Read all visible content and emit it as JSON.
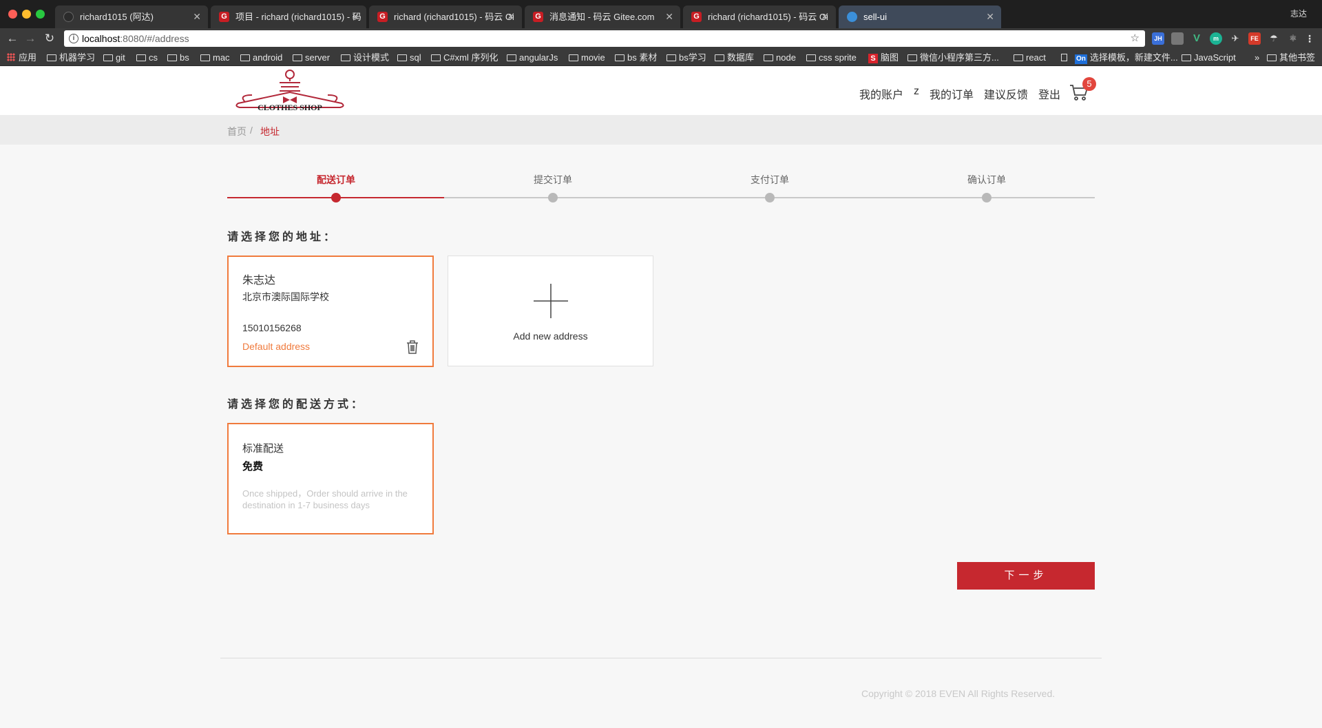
{
  "browser": {
    "tabs": [
      {
        "title": "richard1015 (阿达)",
        "favicon": "github-icon",
        "active": false
      },
      {
        "title": "项目 - richard (richard1015) - 码",
        "favicon": "gitee-icon",
        "active": false
      },
      {
        "title": "richard (richard1015) - 码云 Gi",
        "favicon": "gitee-icon",
        "active": false
      },
      {
        "title": "消息通知 - 码云 Gitee.com",
        "favicon": "gitee-icon",
        "active": false
      },
      {
        "title": "richard (richard1015) - 码云 Gi",
        "favicon": "gitee-icon",
        "active": false
      },
      {
        "title": "sell-ui",
        "favicon": "site-icon",
        "active": true
      }
    ],
    "user_name": "志达",
    "address": {
      "host": "localhost",
      "rest": ":8080/#/address"
    },
    "bookmarks": [
      {
        "label": "应用",
        "kind": "apps"
      },
      {
        "label": "机器学习",
        "kind": "folder"
      },
      {
        "label": "git",
        "kind": "folder"
      },
      {
        "label": "cs",
        "kind": "folder"
      },
      {
        "label": "bs",
        "kind": "folder"
      },
      {
        "label": "mac",
        "kind": "folder"
      },
      {
        "label": "android",
        "kind": "folder"
      },
      {
        "label": "server",
        "kind": "folder"
      },
      {
        "label": "设计模式",
        "kind": "folder"
      },
      {
        "label": "sql",
        "kind": "folder"
      },
      {
        "label": "C#xml 序列化",
        "kind": "folder"
      },
      {
        "label": "angularJs",
        "kind": "folder"
      },
      {
        "label": "movie",
        "kind": "folder"
      },
      {
        "label": "bs 素材",
        "kind": "folder"
      },
      {
        "label": "bs学习",
        "kind": "folder"
      },
      {
        "label": "数据库",
        "kind": "folder"
      },
      {
        "label": "node",
        "kind": "folder"
      },
      {
        "label": "css sprite",
        "kind": "folder"
      },
      {
        "label": "脑图",
        "kind": "s"
      },
      {
        "label": "微信小程序第三方...",
        "kind": "folder"
      },
      {
        "label": "react",
        "kind": "folder"
      },
      {
        "label": "",
        "kind": "doc"
      },
      {
        "label": "选择模板，新建文件...",
        "kind": "on"
      },
      {
        "label": "JavaScript",
        "kind": "folder"
      }
    ],
    "more_bookmarks": "»",
    "other_bookmarks": "其他书签"
  },
  "header": {
    "logo_text": "CLOTHES SHOP",
    "nav": [
      "我的账户",
      "z",
      "我的订单",
      "建议反馈",
      "登出"
    ],
    "cart_count": "5"
  },
  "breadcrumb": {
    "home": "首页",
    "separator": "/",
    "current": "地址"
  },
  "steps": [
    {
      "label": "配送订单",
      "active": true
    },
    {
      "label": "提交订单",
      "active": false
    },
    {
      "label": "支付订单",
      "active": false
    },
    {
      "label": "确认订单",
      "active": false
    }
  ],
  "address_section": {
    "title": "请选择您的地址：",
    "address": {
      "name": "朱志达",
      "line": "北京市澳际国际学校",
      "phone": "15010156268",
      "default_label": "Default address"
    },
    "add_label": "Add new address"
  },
  "shipping_section": {
    "title": "请选择您的配送方式：",
    "method": {
      "name": "标准配送",
      "price": "免费",
      "description": "Once shipped，Order should arrive in the destination in 1-7 business days"
    }
  },
  "next_button": "下一步",
  "footer": {
    "copyright": "Copyright © 2018 EVEN All Rights Reserved."
  },
  "colors": {
    "accent": "#c6282f",
    "selected_border": "#f07a3c",
    "badge": "#e2463d"
  }
}
